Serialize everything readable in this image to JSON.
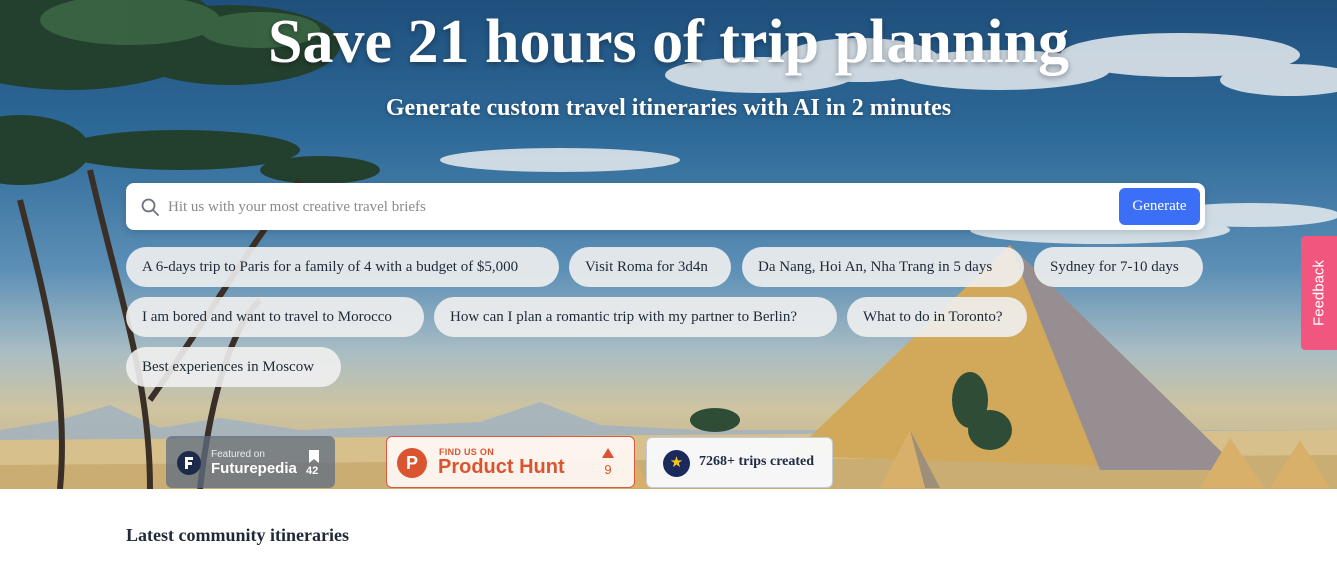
{
  "hero": {
    "title": "Save 21 hours of trip planning",
    "subtitle": "Generate custom travel itineraries with AI in 2 minutes"
  },
  "search": {
    "placeholder": "Hit us with your most creative travel briefs",
    "button_label": "Generate",
    "icon": "search-icon",
    "button_color": "#3b6ff5"
  },
  "suggestions": [
    "A 6-days trip to Paris for a family of 4 with a budget of $5,000",
    "Visit Roma for 3d4n",
    "Da Nang, Hoi An, Nha Trang in 5 days",
    "Sydney for 7-10 days",
    "I am bored and want to travel to Morocco",
    "How can I plan a romantic trip with my partner to Berlin?",
    "What to do in Toronto?",
    "Best experiences in Moscow"
  ],
  "badges": {
    "futurepedia": {
      "small": "Featured on",
      "name": "Futurepedia",
      "count": "42"
    },
    "producthunt": {
      "small": "FIND US ON",
      "name": "Product Hunt",
      "votes": "9",
      "color": "#da552f"
    },
    "trips": {
      "text": "7268+ trips created"
    }
  },
  "feedback": {
    "label": "Feedback",
    "color": "#f0567e"
  },
  "section": {
    "title": "Latest community itineraries"
  }
}
